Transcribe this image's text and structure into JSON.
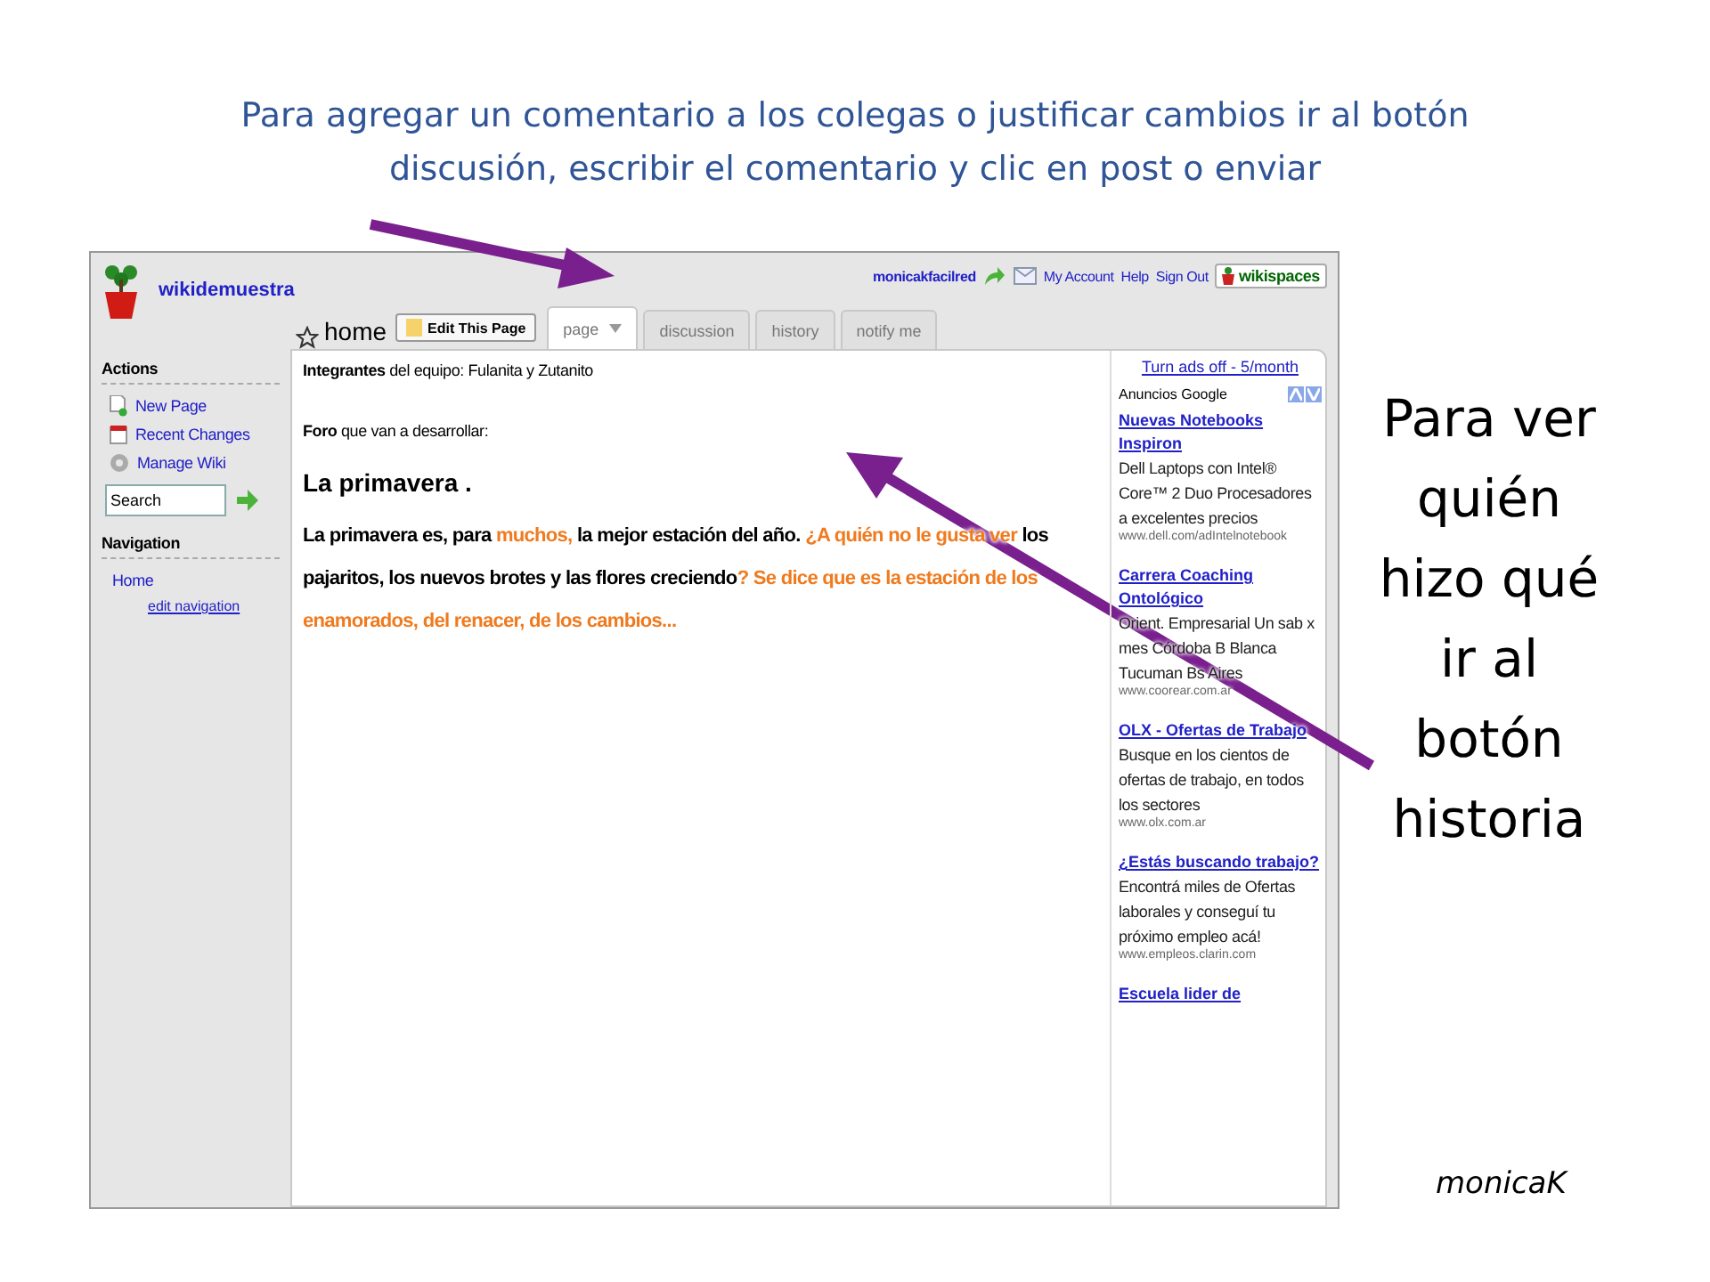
{
  "slide": {
    "caption": "Para agregar un comentario a los colegas o justificar cambios ir al botón discusión, escribir el comentario y clic en post o enviar",
    "side_note": "Para ver quién hizo qué ir al botón historia",
    "author": "monicaK"
  },
  "wiki": {
    "site_name": "wikidemuestra",
    "user_bar": {
      "user": "monicakfacilred",
      "links": [
        "My Account",
        "Help",
        "Sign Out"
      ],
      "badge": "wikispaces"
    },
    "page_title": "home",
    "edit_button": "Edit This Page",
    "tabs": [
      {
        "label": "page",
        "selected": true,
        "dropdown": true
      },
      {
        "label": "discussion",
        "selected": false,
        "dropdown": false
      },
      {
        "label": "history",
        "selected": false,
        "dropdown": false
      },
      {
        "label": "notify me",
        "selected": false,
        "dropdown": false
      }
    ],
    "sidebar": [
      {
        "title": "Actions",
        "items": [
          {
            "label": "New Page",
            "kind": "action"
          },
          {
            "label": "Recent Changes",
            "kind": "action"
          },
          {
            "label": "Manage Wiki",
            "kind": "action"
          },
          {
            "placeholder": "Search",
            "kind": "search"
          }
        ]
      },
      {
        "title": "Navigation",
        "items": [
          {
            "label": "Home",
            "kind": "link"
          },
          {
            "label": "edit navigation",
            "kind": "small"
          }
        ]
      }
    ],
    "content": [
      {
        "kind": "line",
        "text": "**Integrantes** del equipo: Fulanita y Zutanito"
      },
      {
        "kind": "line",
        "text": "**Foro** que van a desarrollar:"
      },
      {
        "kind": "heading",
        "text": "La primavera ."
      },
      {
        "kind": "paragraph",
        "segments": [
          {
            "text": "La primavera es, para ",
            "highlight": false
          },
          {
            "text": "muchos,",
            "highlight": true
          },
          {
            "text": " la mejor estación del año. ",
            "highlight": false
          },
          {
            "text": "¿A quién no le gusta ver",
            "highlight": true
          },
          {
            "text": " los pajaritos, los nuevos brotes y las flores creciendo",
            "highlight": false
          },
          {
            "text": "? Se dice que es la estación de los enamorados, del renacer, de los cambios...",
            "highlight": true
          }
        ]
      }
    ],
    "ads": {
      "turn_off": "Turn ads off - 5/month",
      "label": "Anuncios Google",
      "items": [
        {
          "title": "Nuevas Notebooks Inspiron",
          "body": "Dell Laptops con Intel® Core™ 2 Duo Procesadores a excelentes precios",
          "url": "www.dell.com/adIntelnotebook"
        },
        {
          "title": "Carrera Coaching Ontológico",
          "body": "Orient. Empresarial Un sab x mes Córdoba B Blanca Tucuman Bs Aires",
          "url": "www.coorear.com.ar"
        },
        {
          "title": "OLX - Ofertas de Trabajo",
          "body": "Busque en los cientos de ofertas de trabajo, en todos los sectores",
          "url": "www.olx.com.ar"
        },
        {
          "title": "¿Estás buscando trabajo?",
          "body": "Encontrá miles de Ofertas laborales y conseguí tu próximo empleo acá!",
          "url": "www.empleos.clarin.com"
        },
        {
          "title": "Escuela lider de"
        }
      ]
    }
  }
}
